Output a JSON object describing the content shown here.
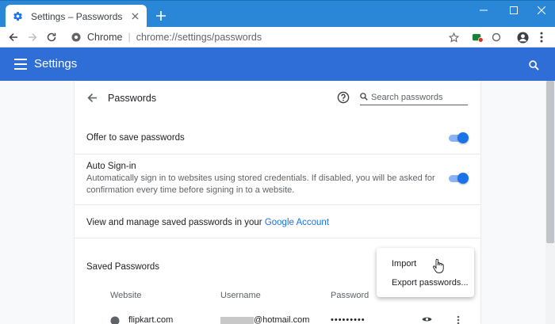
{
  "browser": {
    "tab_title": "Settings – Passwords",
    "omnibox_label": "Chrome",
    "omnibox_url": "chrome://settings/passwords"
  },
  "settings_header": {
    "title": "Settings"
  },
  "passwords_page": {
    "title": "Passwords",
    "search_placeholder": "Search passwords",
    "offer_to_save_label": "Offer to save passwords",
    "offer_to_save_enabled": true,
    "auto_signin_label": "Auto Sign-in",
    "auto_signin_desc_line1": "Automatically sign in to websites using stored credentials. If disabled, you will be asked for",
    "auto_signin_desc_line2": "confirmation every time before signing in to a website.",
    "auto_signin_enabled": true,
    "manage_text": "View and manage saved passwords in your ",
    "manage_link": "Google Account",
    "saved_passwords_heading": "Saved Passwords",
    "columns": [
      "Website",
      "Username",
      "Password"
    ],
    "rows": [
      {
        "website": "flipkart.com",
        "username_visible_part": "@hotmail.com",
        "password_mask": "•••••••••"
      }
    ]
  },
  "menu": {
    "items": [
      "Import",
      "Export passwords..."
    ]
  },
  "colors": {
    "tabstrip": "#2a86d6",
    "header": "#2f6ed6",
    "toggle_on": "#1a73e8",
    "link": "#1a73e8"
  }
}
